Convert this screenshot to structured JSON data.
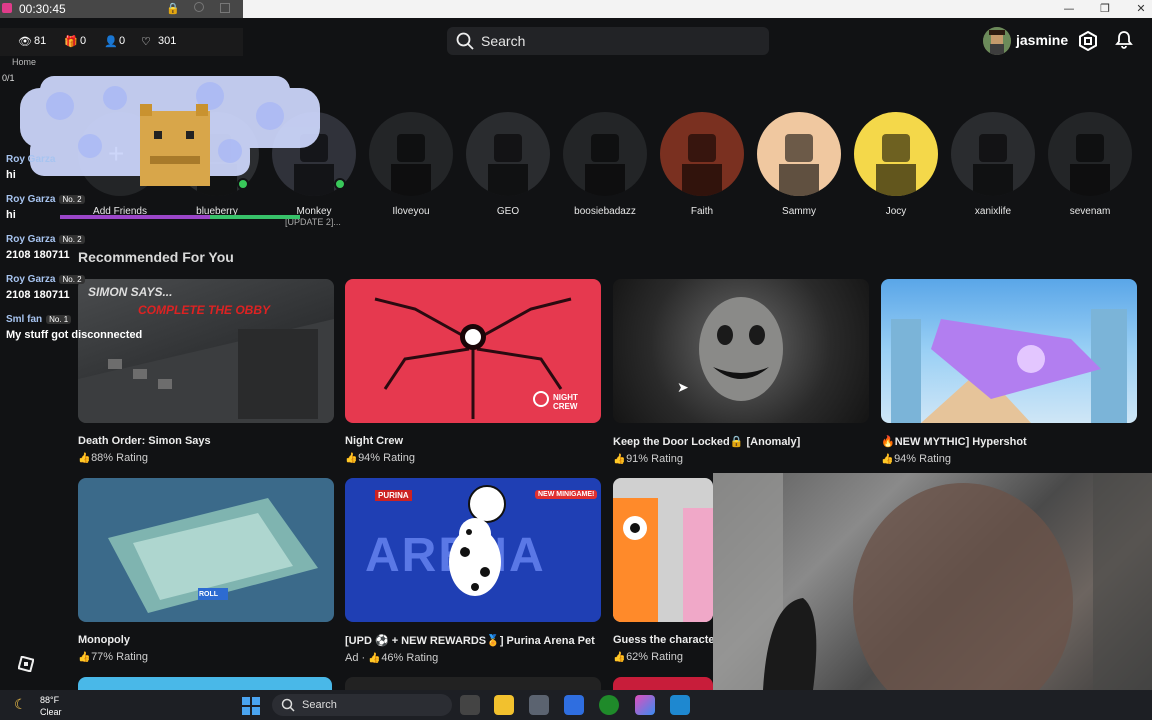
{
  "window": {
    "minimize_glyph": "—",
    "maximize_glyph": "❐",
    "close_glyph": "✕"
  },
  "overlay": {
    "timer": "00:30:45",
    "stats": {
      "viewers": "81",
      "gifts": "0",
      "follows": "0",
      "likes": "301"
    },
    "side_label": "Home",
    "progress": "0/1"
  },
  "header": {
    "search_placeholder": "Search",
    "username": "jasmine"
  },
  "friends": [
    {
      "name": "Add Friends",
      "online": false
    },
    {
      "name": "blueberry",
      "online": true
    },
    {
      "name": "Monkey",
      "online": true
    },
    {
      "name": "Iloveyou",
      "online": false
    },
    {
      "name": "GEO",
      "online": false
    },
    {
      "name": "boosiebadazz",
      "online": false
    },
    {
      "name": "Faith",
      "online": false
    },
    {
      "name": "Sammy",
      "online": false
    },
    {
      "name": "Jocy",
      "online": false
    },
    {
      "name": "xanixlife",
      "online": false
    },
    {
      "name": "sevenam",
      "online": false
    }
  ],
  "monkey_status": "[UPDATE 2]...",
  "section_title": "Recommended For You",
  "games_row1": [
    {
      "title": "Death Order: Simon Says",
      "rating": "88% Rating",
      "thumb_text_1": "SIMON SAYS...",
      "thumb_text_2": "COMPLETE THE OBBY"
    },
    {
      "title": "Night Crew",
      "rating": "94% Rating",
      "badge": "NIGHT CREW"
    },
    {
      "title": "Keep the Door Locked🔒 [Anomaly]",
      "rating": "91% Rating"
    },
    {
      "title": "🔥NEW MYTHIC] Hypershot",
      "rating": "94% Rating"
    }
  ],
  "games_row2": [
    {
      "title": "Monopoly",
      "rating": "77% Rating",
      "thumb_text": "ROLL"
    },
    {
      "title": "[UPD ⚽ + NEW REWARDS🏅] Purina Arena Pet",
      "rating": "46% Rating",
      "ad": "Ad",
      "brand": "PURINA",
      "tag": "NEW MINIGAME!",
      "logo": "ARENA"
    },
    {
      "title": "Guess the characte",
      "rating": "62% Rating"
    }
  ],
  "chat": [
    {
      "name": "Roy Garza",
      "badge": "",
      "msg": "hi"
    },
    {
      "name": "Roy Garza",
      "badge": "No. 2",
      "msg": "hi"
    },
    {
      "name": "Roy Garza",
      "badge": "No. 2",
      "msg": "2108 180711"
    },
    {
      "name": "Roy Garza",
      "badge": "No. 2",
      "msg": "2108 180711"
    },
    {
      "name": "Sml fan",
      "badge": "No. 1",
      "msg": "My stuff got disconnected"
    }
  ],
  "taskbar": {
    "temp": "88°F",
    "condition": "Clear",
    "search": "Search"
  },
  "colors": {
    "background": "#111214",
    "online": "#39c85a",
    "night_crew_red": "#e6394f",
    "purina_blue": "#1f3fb4"
  }
}
